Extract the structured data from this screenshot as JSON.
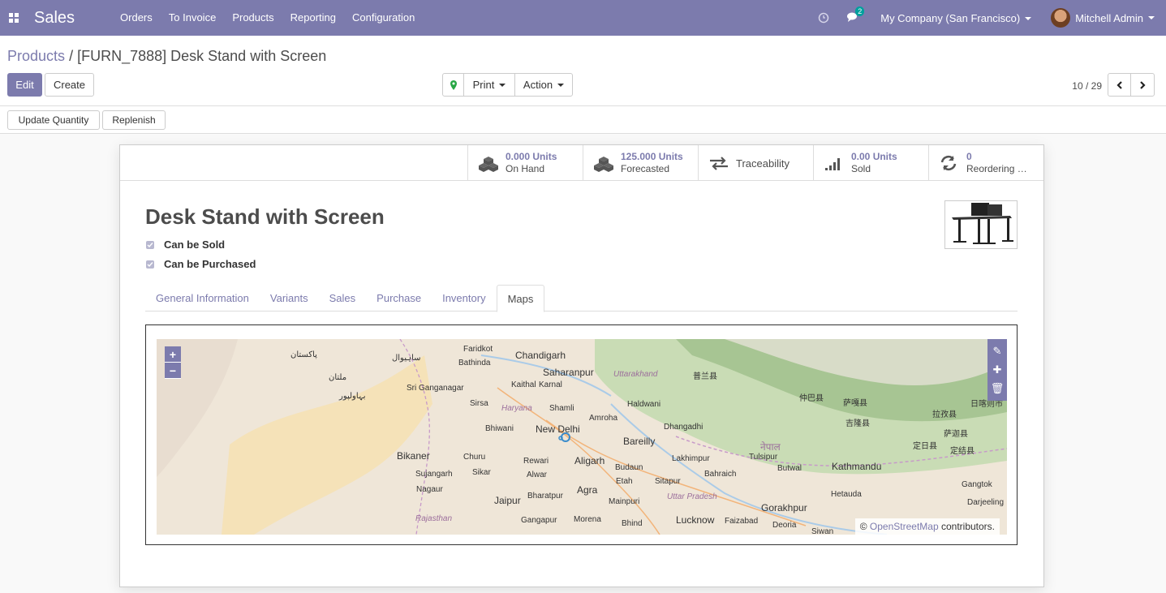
{
  "navbar": {
    "app_name": "Sales",
    "menu": [
      "Orders",
      "To Invoice",
      "Products",
      "Reporting",
      "Configuration"
    ],
    "chat_count": "2",
    "company": "My Company (San Francisco)",
    "user": "Mitchell Admin",
    "accent_color": "#7c7bad"
  },
  "breadcrumb": {
    "parent": "Products",
    "separator": "/",
    "current": "[FURN_7888] Desk Stand with Screen"
  },
  "buttons": {
    "edit": "Edit",
    "create": "Create",
    "print": "Print",
    "action": "Action",
    "update_quantity": "Update Quantity",
    "replenish": "Replenish"
  },
  "pager": {
    "text": "10 / 29"
  },
  "smart_buttons": [
    {
      "value": "0.000 Units",
      "label": "On Hand",
      "icon": "cubes-icon"
    },
    {
      "value": "125.000 Units",
      "label": "Forecasted",
      "icon": "cubes-icon"
    },
    {
      "label": "Traceability",
      "icon": "exchange-arrows-icon"
    },
    {
      "value": "0.00 Units",
      "label": "Sold",
      "icon": "signal-bars-icon"
    },
    {
      "value": "0",
      "label": "Reordering …",
      "icon": "refresh-icon"
    }
  ],
  "product": {
    "name": "Desk Stand with Screen",
    "can_be_sold": "Can be Sold",
    "can_be_purchased": "Can be Purchased"
  },
  "tabs": [
    "General Information",
    "Variants",
    "Sales",
    "Purchase",
    "Inventory",
    "Maps"
  ],
  "active_tab": "Maps",
  "map": {
    "zoom_in": "+",
    "zoom_out": "−",
    "attribution_prefix": "©",
    "attribution_link": "OpenStreetMap",
    "attribution_suffix": "contributors.",
    "labels": {
      "chandigarh": "Chandigarh",
      "saharanpur": "Saharanpur",
      "uttarakhand": "Uttarakhand",
      "new_delhi": "New Delhi",
      "bikaner": "Bikaner",
      "aligarh": "Aligarh",
      "bareilly": "Bareilly",
      "jaipur": "Jaipur",
      "agra": "Agra",
      "lucknow": "Lucknow",
      "gorakhpur": "Gorakhpur",
      "kathmandu": "Kathmandu",
      "uttar_pradesh": "Uttar Pradesh",
      "haryana": "Haryana",
      "rajasthan": "Rajasthan",
      "bathinda": "Bathinda",
      "sri_ganganagar": "Sri Ganganagar",
      "churu": "Churu",
      "rewari": "Rewari",
      "sikar": "Sikar",
      "nagaur": "Nagaur",
      "sujangarh": "Sujangarh",
      "haldwani": "Haldwani",
      "bahraich": "Bahraich",
      "lakhimpur": "Lakhimpur",
      "tulsipur": "Tulsipur",
      "butwal": "Butwal",
      "hetauda": "Hetauda",
      "gangtok": "Gangtok",
      "darjeeling": "Darjeeling",
      "siwan": "Siwan",
      "faizabad": "Faizabad",
      "deoria": "Deoria",
      "mainpuri": "Mainpuri",
      "etah": "Etah",
      "sitapur": "Sitapur",
      "budaun": "Budaun",
      "bhind": "Bhind",
      "morena": "Morena",
      "gangapur": "Gangapur",
      "bharatpur": "Bharatpur",
      "alwar": "Alwar",
      "bhiwani": "Bhiwani",
      "amroha": "Amroha",
      "dhangadhi": "Dhangadhi",
      "shamli": "Shamli",
      "karnal": "Karnal",
      "kaithal": "Kaithal",
      "sirsa": "Sirsa",
      "faridkot": "Faridkot",
      "pakistan": "پاکستان",
      "multan": "ملتان",
      "bahawalpur": "بہاولپور",
      "sahiwal": "ساہیوال",
      "nepal": "नेपाल",
      "china_1": "普兰县",
      "china_2": "仲巴县",
      "china_3": "萨嘎县",
      "china_4": "吉隆县",
      "china_5": "定日县",
      "china_6": "拉孜县",
      "china_7": "萨迦县",
      "china_8": "日喀则市",
      "china_9": "定结县"
    }
  }
}
